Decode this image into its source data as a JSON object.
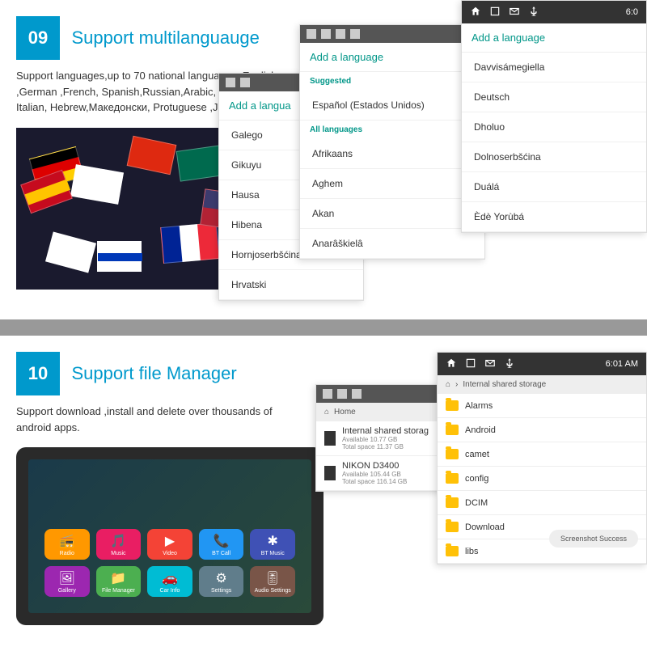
{
  "section1": {
    "badge": "09",
    "title": "Support multilanguauge",
    "desc": "Support languages,up to 70 national languages, English ,German ,French, Spanish,Russian,Arabic, Chinese, Italian, Hebrew,Македонски, Protuguese ,Japanese,etc."
  },
  "section2": {
    "badge": "10",
    "title": "Support file Manager",
    "desc": "Support download ,install and delete over thousands of android apps."
  },
  "status_time": "6:0",
  "status_time2": "6:01 AM",
  "lang_screens": {
    "header": "Add a language",
    "suggested": "Suggested",
    "all": "All languages",
    "s1_header": "Add a langua",
    "s1_items": [
      "Galego",
      "Gikuyu",
      "Hausa",
      "Hibena",
      "Hornjoserbšćina",
      "Hrvatski"
    ],
    "s2_items": [
      "Español (Estados Unidos)",
      "Afrikaans",
      "Aghem",
      "Akan",
      "Anarâškielâ"
    ],
    "s3_items": [
      "Davvisámegiella",
      "Deutsch",
      "Dholuo",
      "Dolnoserbšćina",
      "Duálá",
      "Èdè Yorùbá"
    ]
  },
  "apps": [
    {
      "label": "Radio",
      "glyph": "📻"
    },
    {
      "label": "Music",
      "glyph": "🎵"
    },
    {
      "label": "Video",
      "glyph": "▶"
    },
    {
      "label": "BT Call",
      "glyph": "📞"
    },
    {
      "label": "BT Music",
      "glyph": "✱"
    },
    {
      "label": "Gallery",
      "glyph": "🖼"
    },
    {
      "label": "File Manager",
      "glyph": "📁"
    },
    {
      "label": "Car Info",
      "glyph": "🚗"
    },
    {
      "label": "Settings",
      "glyph": "⚙"
    },
    {
      "label": "Audio Settings",
      "glyph": "🎚"
    }
  ],
  "fm": {
    "home": "Home",
    "breadcrumb": "Internal shared storage",
    "storage1": {
      "name": "Internal shared storag",
      "l1": "Available 10.77 GB",
      "l2": "Total space 11.37 GB"
    },
    "storage2": {
      "name": "NIKON D3400",
      "l1": "Available 105.44 GB",
      "l2": "Total space 116.14 GB"
    },
    "folders": [
      "Alarms",
      "Android",
      "camet",
      "config",
      "DCIM",
      "Download",
      "libs"
    ],
    "toast": "Screenshot Success"
  }
}
